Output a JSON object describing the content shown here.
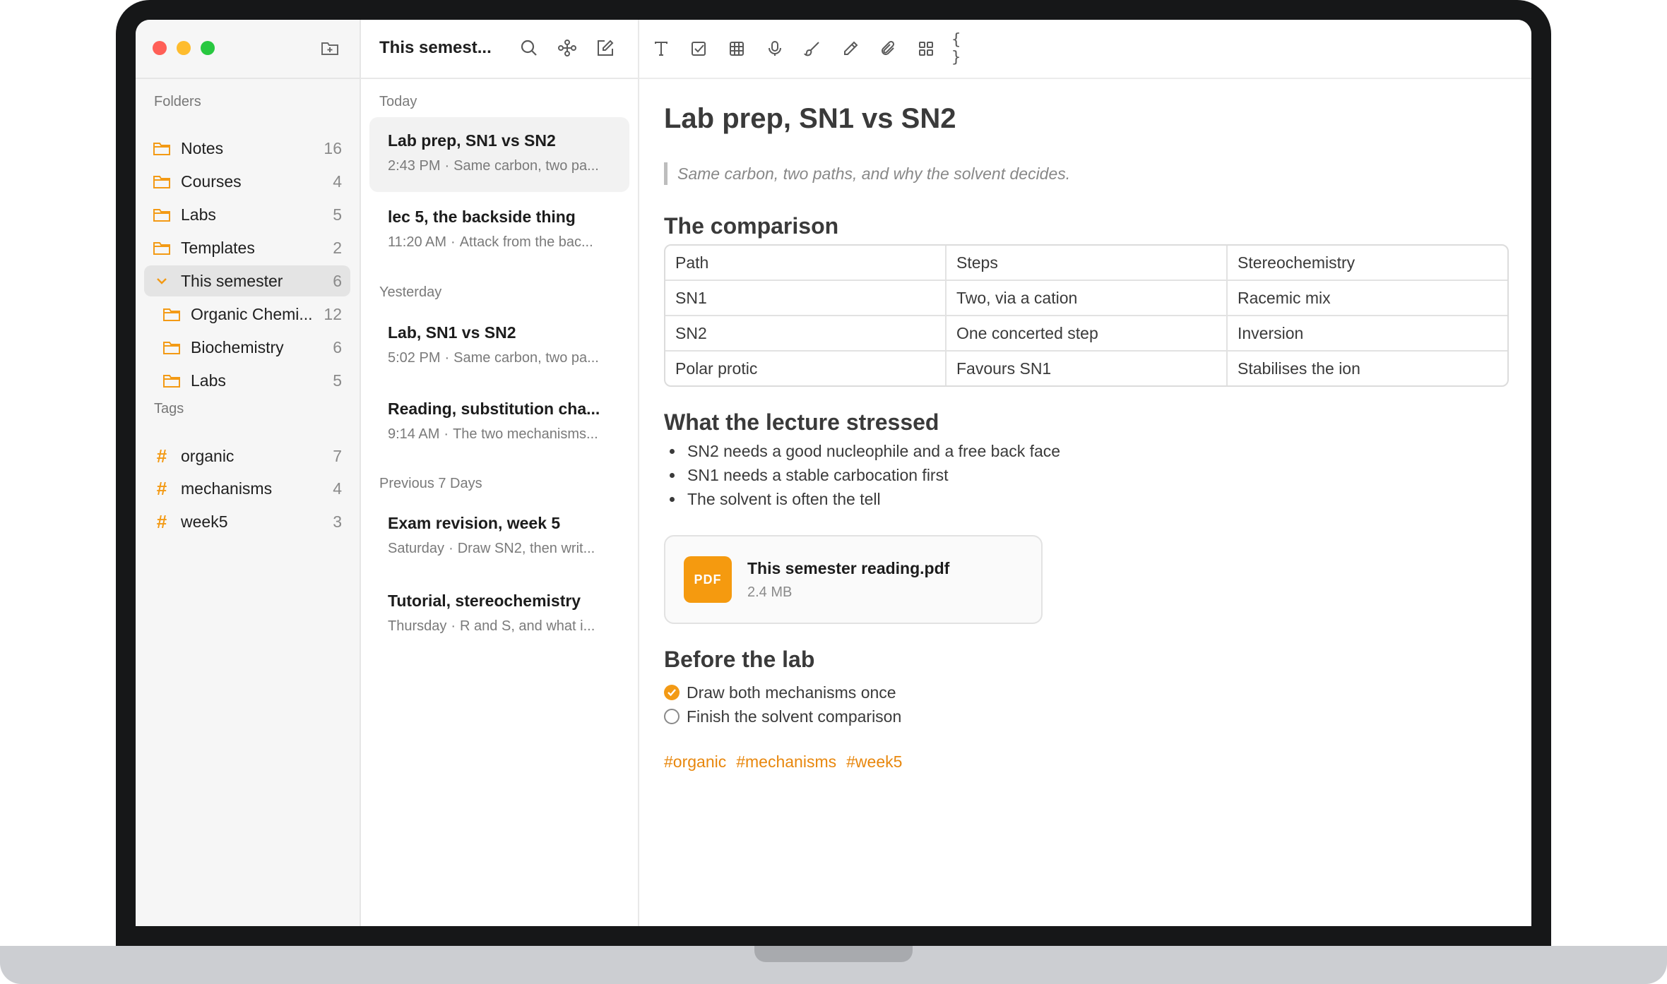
{
  "sidebar": {
    "folders_title": "Folders",
    "folders": [
      {
        "label": "Notes",
        "count": "16"
      },
      {
        "label": "Courses",
        "count": "4"
      },
      {
        "label": "Labs",
        "count": "5"
      },
      {
        "label": "Templates",
        "count": "2"
      },
      {
        "label": "This semester",
        "count": "6"
      },
      {
        "label": "Organic Chemi...",
        "count": "12"
      },
      {
        "label": "Biochemistry",
        "count": "6"
      },
      {
        "label": "Labs",
        "count": "5"
      }
    ],
    "tags_title": "Tags",
    "tags": [
      {
        "label": "organic",
        "count": "7"
      },
      {
        "label": "mechanisms",
        "count": "4"
      },
      {
        "label": "week5",
        "count": "3"
      }
    ]
  },
  "notelist": {
    "title": "This semest...",
    "sections": {
      "today": "Today",
      "yesterday": "Yesterday",
      "previous": "Previous 7 Days"
    },
    "notes": [
      {
        "title": "Lab prep, SN1 vs SN2",
        "time": "2:43 PM",
        "preview": "Same carbon, two pa..."
      },
      {
        "title": "lec 5, the backside thing",
        "time": "11:20 AM",
        "preview": "Attack from the bac..."
      },
      {
        "title": "Lab, SN1 vs SN2",
        "time": "5:02 PM",
        "preview": "Same carbon, two pa..."
      },
      {
        "title": "Reading, substitution cha...",
        "time": "9:14 AM",
        "preview": "The two mechanisms..."
      },
      {
        "title": "Exam revision, week 5",
        "time": "Saturday",
        "preview": "Draw SN2, then writ..."
      },
      {
        "title": "Tutorial, stereochemistry",
        "time": "Thursday",
        "preview": "R and S, and what i..."
      }
    ]
  },
  "doc": {
    "title": "Lab prep, SN1 vs SN2",
    "quote": "Same carbon, two paths, and why the solvent decides.",
    "h_comparison": "The comparison",
    "table": {
      "headers": [
        "Path",
        "Steps",
        "Stereochemistry"
      ],
      "rows": [
        [
          "SN1",
          "Two, via a cation",
          "Racemic mix"
        ],
        [
          "SN2",
          "One concerted step",
          "Inversion"
        ],
        [
          "Polar protic",
          "Favours SN1",
          "Stabilises the ion"
        ]
      ]
    },
    "h_lecture": "What the lecture stressed",
    "bullets": [
      "SN2 needs a good nucleophile and a free back face",
      "SN1 needs a stable carbocation first",
      "The solvent is often the tell"
    ],
    "attachment": {
      "icon_text": "PDF",
      "name": "This semester reading.pdf",
      "size": "2.4 MB"
    },
    "h_lab": "Before the lab",
    "checklist": [
      {
        "label": "Draw both mechanisms once",
        "done": true
      },
      {
        "label": "Finish the solvent comparison",
        "done": false
      }
    ],
    "tags": [
      "#organic",
      "#mechanisms",
      "#week5"
    ]
  },
  "toolbar": {
    "icons": [
      "text-format-icon",
      "checklist-icon",
      "table-icon",
      "microphone-icon",
      "brush-icon",
      "pencil-icon",
      "paperclip-icon",
      "grid-icon",
      "code-braces-icon",
      "more-icon",
      "settings-icon",
      "sidebar-toggle-icon"
    ],
    "code_glyph": "{ }"
  },
  "colors": {
    "accent": "#f39a15",
    "tag": "#e8870d",
    "pdf": "#f59a0f"
  }
}
